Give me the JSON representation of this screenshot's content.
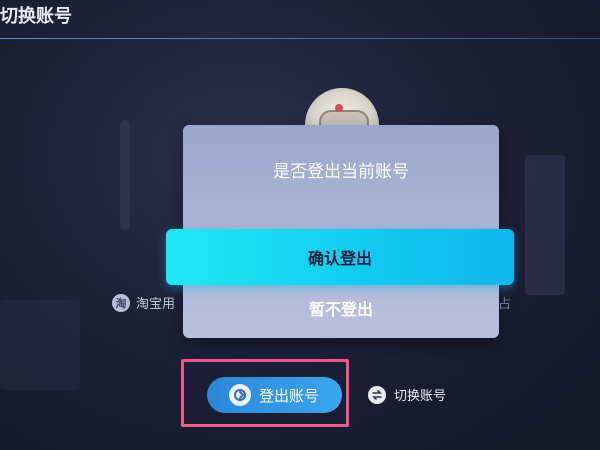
{
  "page": {
    "title": "切换账号"
  },
  "account": {
    "name": "淘宝用",
    "tail": "占",
    "icon": "taobao-icon",
    "icon_glyph": "淘"
  },
  "dialog": {
    "title": "是否登出当前账号",
    "confirm_label": "确认登出",
    "cancel_label": "暂不登出"
  },
  "footer": {
    "logout_label": "登出账号",
    "switch_label": "切换账号",
    "logout_icon": "logout-icon",
    "switch_icon": "switch-icon"
  },
  "colors": {
    "confirm_accent": "#1ee9f4",
    "logout_button": "#3aa6ef",
    "highlight_border": "#ee5a88"
  }
}
